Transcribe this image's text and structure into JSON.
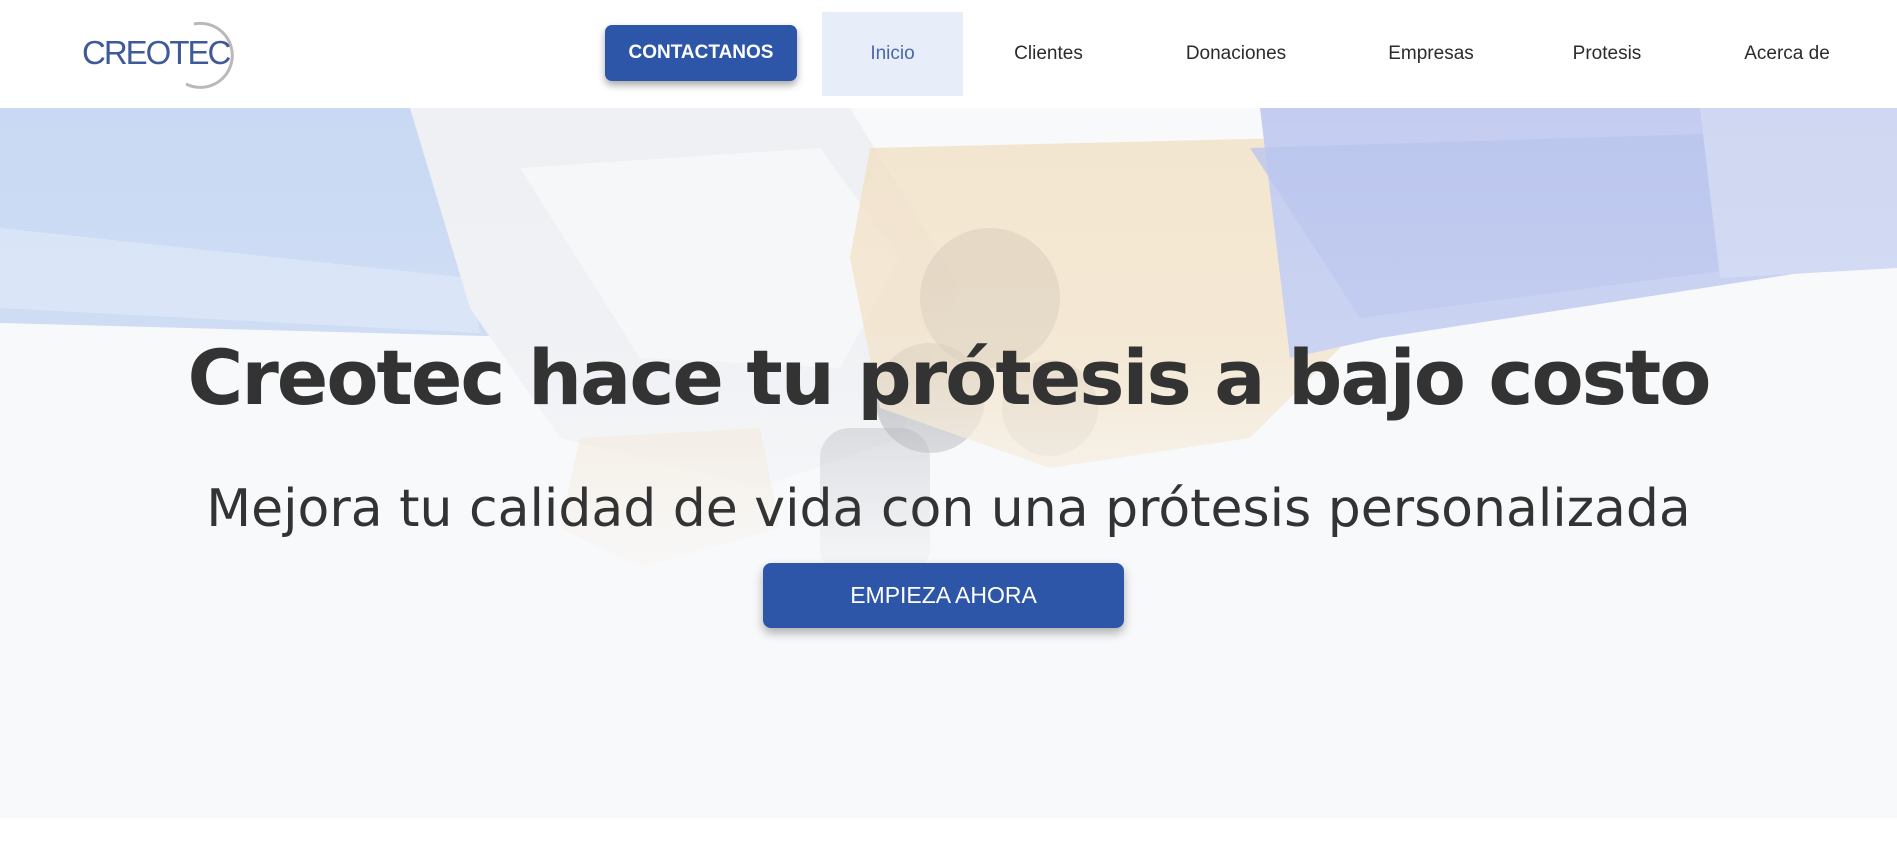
{
  "header": {
    "logo_text": "CREOTEC",
    "contact_label": "CONTACTANOS",
    "nav": [
      {
        "label": "Inicio",
        "active": true
      },
      {
        "label": "Clientes",
        "active": false
      },
      {
        "label": "Donaciones",
        "active": false
      },
      {
        "label": "Empresas",
        "active": false
      },
      {
        "label": "Protesis",
        "active": false
      },
      {
        "label": "Acerca de",
        "active": false
      }
    ]
  },
  "hero": {
    "title": "Creotec hace tu prótesis a bajo costo",
    "subtitle": "Mejora tu calidad de vida con una prótesis personalizada",
    "cta_label": "EMPIEZA AHORA",
    "background_image": "handshake-image"
  },
  "colors": {
    "brand_blue": "#2d56a8",
    "active_nav_bg": "#e7eefa",
    "text_dark": "#333333"
  }
}
